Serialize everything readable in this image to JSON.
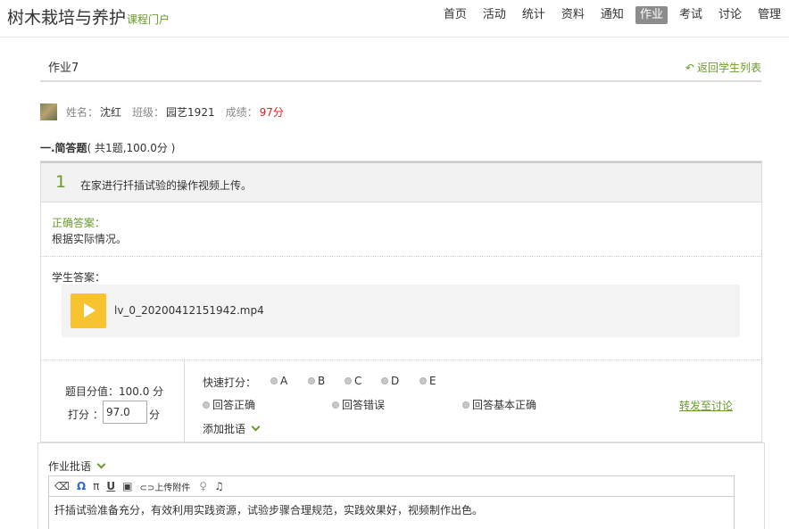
{
  "header": {
    "brand": "树木栽培与养护",
    "brand_sub": "课程门户",
    "nav": [
      "首页",
      "活动",
      "统计",
      "资料",
      "通知",
      "作业",
      "考试",
      "讨论",
      "管理"
    ],
    "active_nav": "作业"
  },
  "assignment": {
    "title": "作业7",
    "back_label": "返回学生列表"
  },
  "student": {
    "name_label": "姓名：",
    "name": "沈红",
    "class_label": "班级：",
    "class": "园艺1921",
    "score_label": "成绩：",
    "score": "97分"
  },
  "section": {
    "title": "一.简答题",
    "meta": "( 共1题,100.0分 )"
  },
  "question": {
    "number": "1",
    "text": "在家进行扦插试验的操作视频上传。",
    "correct_label": "正确答案：",
    "correct_answer": "根据实际情况。",
    "student_label": "学生答案：",
    "file_name": "lv_0_20200412151942.mp4"
  },
  "grading": {
    "question_score": "题目分值：100.0 分",
    "give_label": "打分 ：",
    "score_value": "97.0",
    "unit": "分",
    "quick_label": "快速打分：",
    "quick_options": [
      "A",
      "B",
      "C",
      "D",
      "E"
    ],
    "comment_options": [
      "回答正确",
      "回答错误",
      "回答基本正确"
    ],
    "forward_label": "转发至讨论",
    "add_comment_label": "添加批语"
  },
  "feedback": {
    "label": "作业批语",
    "toolbar_upload": "上传附件",
    "text": "扦插试验准备充分，有效利用实践资源，试验步骤合理规范，实践效果好，视频制作出色。"
  },
  "colors": {
    "accent": "#6a9a2c",
    "score_red": "#e02020",
    "play_yellow": "#f7c331"
  }
}
